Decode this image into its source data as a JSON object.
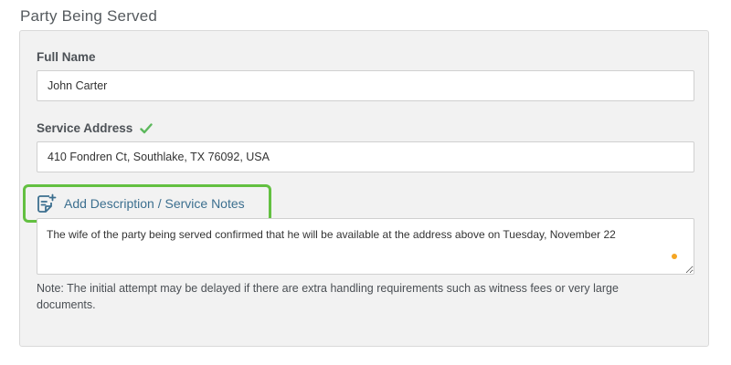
{
  "section": {
    "title": "Party Being Served"
  },
  "full_name": {
    "label": "Full Name",
    "value": "John Carter"
  },
  "service_address": {
    "label": "Service Address",
    "value": "410 Fondren Ct, Southlake, TX 76092, USA",
    "verified_icon": "checkmark-icon",
    "verified_color": "#5cb85c"
  },
  "notes": {
    "link_label": "Add Description / Service Notes",
    "link_icon": "note-add-icon",
    "highlight_color": "#63c041",
    "value": "The wife of the party being served confirmed that he will be available at the address above on Tuesday, November 22"
  },
  "footer_note": "Note: The initial attempt may be delayed if there are extra handling requirements such as witness fees or very large documents."
}
